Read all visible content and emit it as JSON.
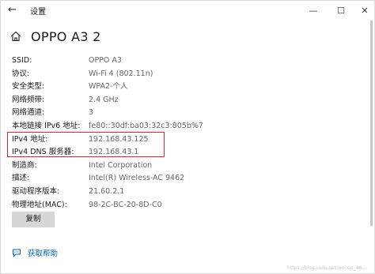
{
  "titlebar": {
    "app_name": "设置",
    "minimize": "—",
    "maximize": "☐",
    "close": "✕"
  },
  "header": {
    "title": "OPPO A3 2"
  },
  "properties": [
    {
      "label": "SSID:",
      "value": "OPPO A3"
    },
    {
      "label": "协议:",
      "value": "Wi-Fi 4 (802.11n)"
    },
    {
      "label": "安全类型:",
      "value": "WPA2-个人"
    },
    {
      "label": "网络频带:",
      "value": "2.4 GHz"
    },
    {
      "label": "网络通道:",
      "value": "3"
    },
    {
      "label": "本地链接 IPv6 地址:",
      "value": "fe80::30df:ba03:32c3:805b%7"
    },
    {
      "label": "IPv4 地址:",
      "value": "192.168.43.125"
    },
    {
      "label": "IPv4 DNS 服务器:",
      "value": "192.168.43.1"
    },
    {
      "label": "制造商:",
      "value": "Intel Corporation"
    },
    {
      "label": "描述:",
      "value": "Intel(R) Wireless-AC 9462"
    },
    {
      "label": "驱动程序版本:",
      "value": "21.60.2.1"
    },
    {
      "label": "物理地址(MAC):",
      "value": "98-2C-BC-20-8D-C0"
    }
  ],
  "actions": {
    "copy_label": "复制",
    "help_label": "获取帮助"
  },
  "watermark": "https://blog.csdn.net/weixin_46...",
  "colors": {
    "highlight": "#e0262e",
    "link": "#0063b1",
    "button_bg": "#d6d6d6"
  },
  "icons": {
    "back": "back-arrow-icon",
    "home": "home-icon",
    "help": "help-chat-icon"
  }
}
